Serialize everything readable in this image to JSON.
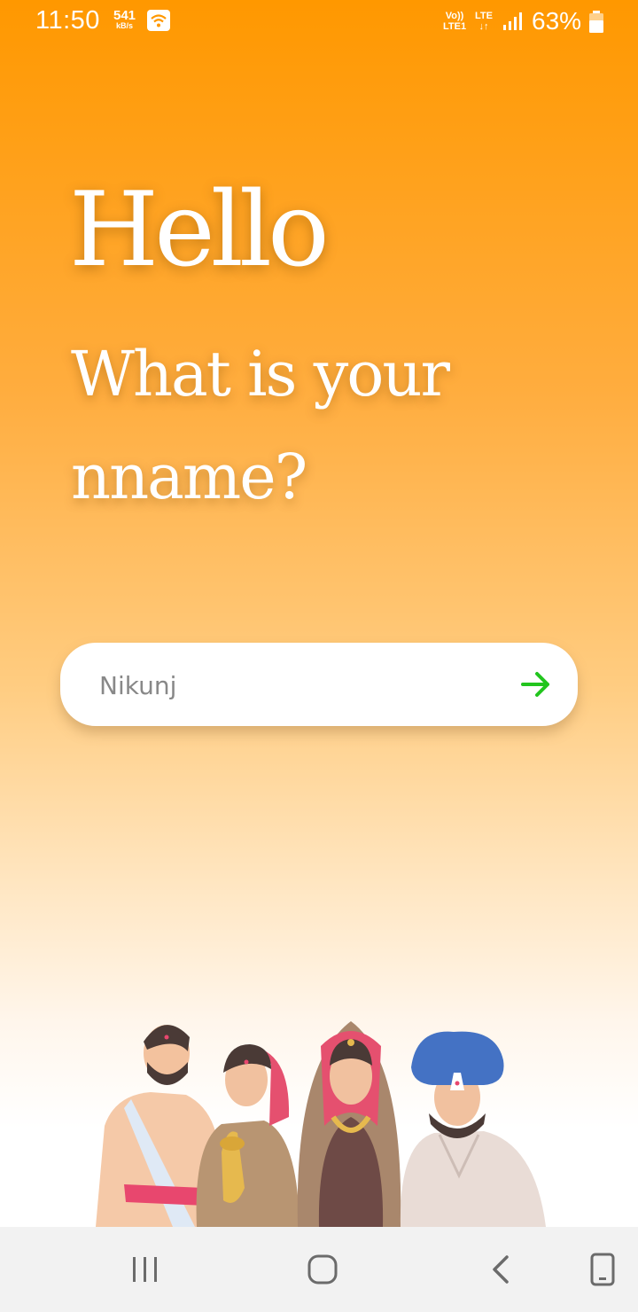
{
  "status_bar": {
    "time": "11:50",
    "net_speed_value": "541",
    "net_speed_unit": "kB/s",
    "volte_top": "Vo))",
    "volte_bottom": "LTE1",
    "lte_top": "LTE",
    "lte_bottom": "↓↑",
    "battery_percent": "63%",
    "icons": [
      "wifi-icon",
      "signal-icon",
      "battery-icon"
    ]
  },
  "greeting": {
    "title": "Hello",
    "question": "What is your nname?"
  },
  "name_field": {
    "value": "",
    "placeholder": "Nikunj",
    "submit_icon": "arrow-right-icon",
    "submit_color": "#22c51e"
  },
  "illustration": {
    "name": "indian-people-illustration"
  },
  "nav_bar": {
    "buttons": [
      "recent-apps-icon",
      "home-icon",
      "back-icon",
      "screen-rotate-icon"
    ]
  },
  "colors": {
    "background_top": "#ff9800",
    "background_bottom": "#ffffff",
    "text": "#ffffff",
    "accent": "#22c51e"
  }
}
